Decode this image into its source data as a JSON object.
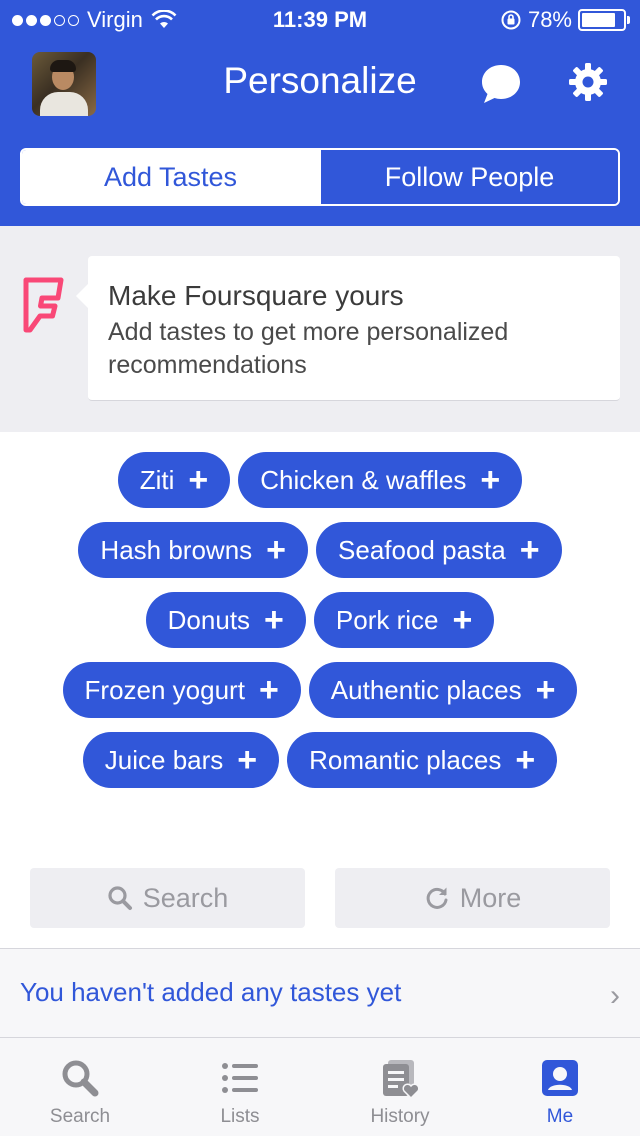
{
  "status_bar": {
    "carrier": "Virgin",
    "time": "11:39 PM",
    "battery": "78%",
    "battery_level": 0.78
  },
  "nav": {
    "title": "Personalize"
  },
  "segments": {
    "add_tastes": "Add Tastes",
    "follow_people": "Follow People"
  },
  "intro": {
    "title": "Make Foursquare yours",
    "text": "Add tastes to get more personalized recommendations"
  },
  "tastes": [
    [
      "Ziti",
      "Chicken & waffles"
    ],
    [
      "Hash browns",
      "Seafood pasta"
    ],
    [
      "Donuts",
      "Pork rice"
    ],
    [
      "Frozen yogurt",
      "Authentic places"
    ],
    [
      "Juice bars",
      "Romantic places"
    ]
  ],
  "actions": {
    "search": "Search",
    "more": "More"
  },
  "no_tastes": {
    "text": "You haven't added any tastes yet"
  },
  "tab_bar": {
    "search": "Search",
    "lists": "Lists",
    "history": "History",
    "me": "Me"
  },
  "colors": {
    "brand_blue": "#3157d9",
    "foursquare_pink": "#f94877"
  }
}
